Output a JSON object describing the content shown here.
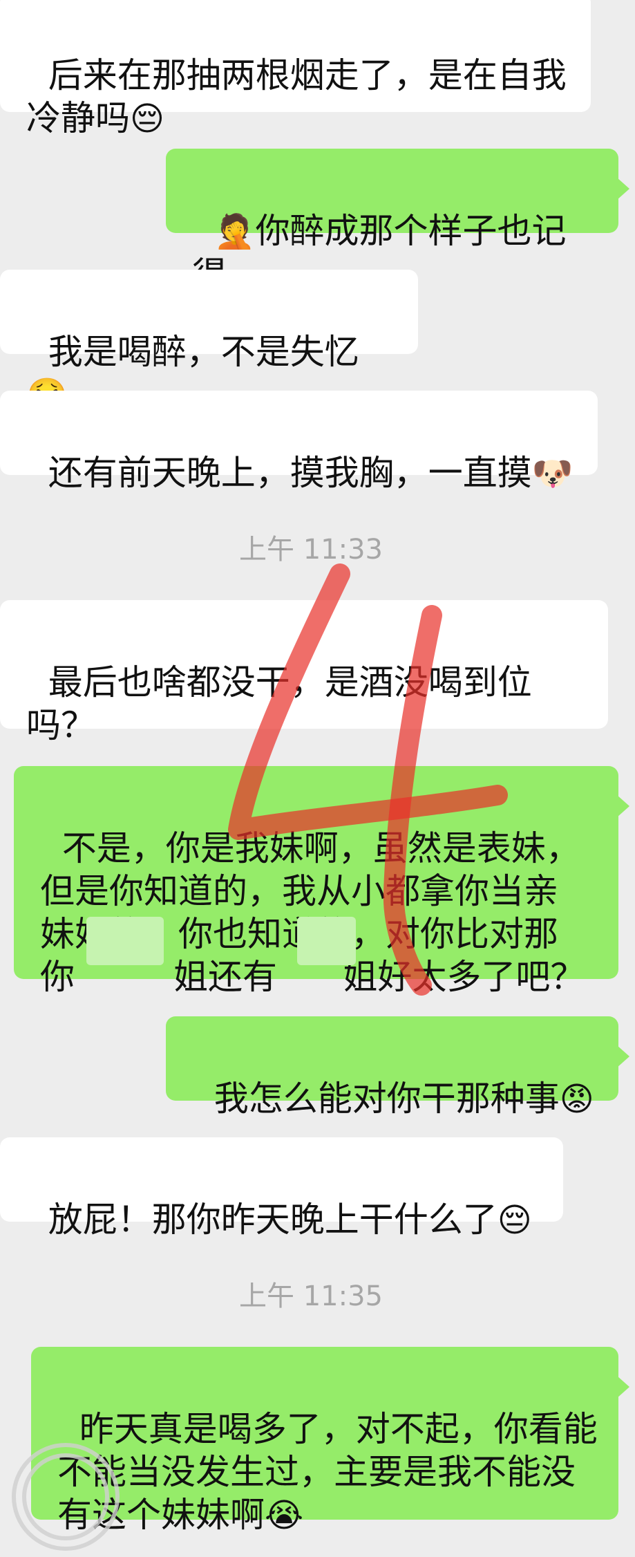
{
  "messages": [
    {
      "id": "m1",
      "side": "left",
      "text": "后来在那抽两根烟走了，是在自我\n冷静吗",
      "emoji": "😔"
    },
    {
      "id": "m2",
      "side": "right",
      "text": "你醉成那个样子也记得",
      "emoji": "🤦"
    },
    {
      "id": "m3",
      "side": "left",
      "text": "我是喝醉，不是失忆",
      "emoji": "🤮"
    },
    {
      "id": "m4",
      "side": "left",
      "text": "还有前天晚上，摸我胸，一直摸",
      "emoji": "🐶"
    },
    {
      "id": "m5",
      "side": "left",
      "text": "最后也啥都没干，是酒没喝到位吗？",
      "emoji": "🐶"
    },
    {
      "id": "m6",
      "side": "right",
      "text": "不是，你是我妹啊，虽然是表妹，\n但是你知道的，我从小都拿你当亲\n妹妹的，你也知道的，对你比对那\n你         姐还有      姐好太多了吧？"
    },
    {
      "id": "m7",
      "side": "right",
      "text": "我怎么能对你干那种事",
      "emoji": "😡"
    },
    {
      "id": "m8",
      "side": "left",
      "text": "放屁！那你昨天晚上干什么了",
      "emoji": "😔"
    },
    {
      "id": "m9",
      "side": "right",
      "text": "昨天真是喝多了，对不起，你看能\n不能当没发生过，主要是我不能没\n有这个妹妹啊",
      "emoji": "😭"
    }
  ],
  "timestamps": {
    "t1": "上午 11:33",
    "t2": "上午 11:35"
  },
  "overlay_glyph": "4",
  "colors": {
    "self_bubble": "#95ec69",
    "other_bubble": "#ffffff",
    "background": "#ededed",
    "timestamp": "#a6a6a6",
    "annotation": "#e8302a"
  }
}
